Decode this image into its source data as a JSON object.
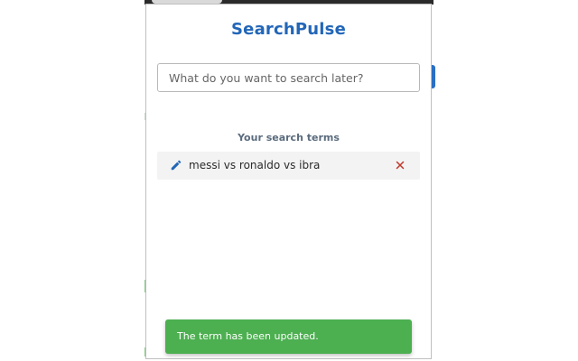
{
  "app": {
    "title": "SearchPulse"
  },
  "search": {
    "placeholder": "What do you want to search later?",
    "value": ""
  },
  "terms_section": {
    "label": "Your search terms",
    "items": [
      {
        "text": "messi vs ronaldo vs ibra",
        "edit_icon": "pencil-icon",
        "delete_icon": "close-icon"
      }
    ]
  },
  "toast": {
    "message": "The term has been updated."
  },
  "colors": {
    "accent": "#2266b8",
    "toast_bg": "#4caf50",
    "delete": "#c0392b"
  }
}
